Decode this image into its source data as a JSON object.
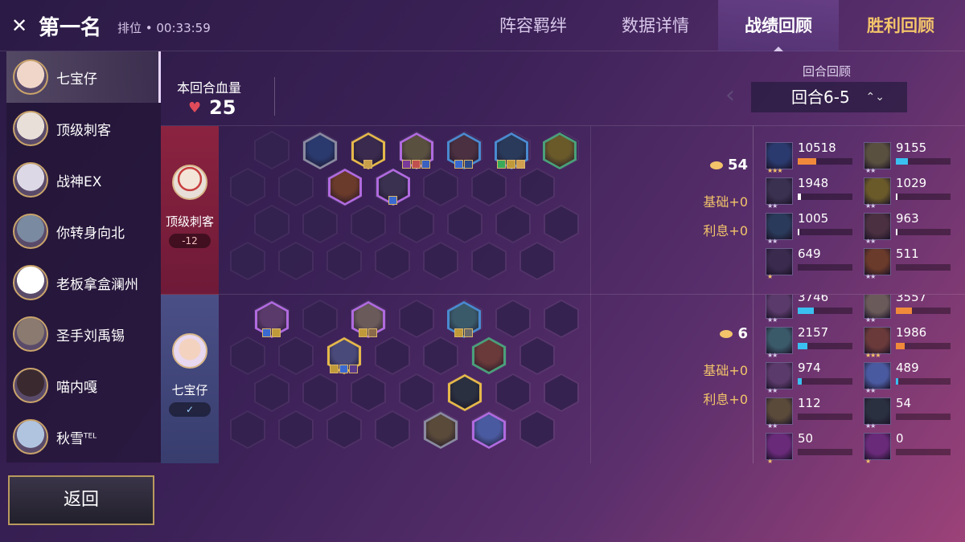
{
  "header": {
    "title": "第一名",
    "subtitle": "排位 • 00:33:59",
    "logo_icon": "crossed-swords-icon"
  },
  "tabs": [
    {
      "label": "阵容羁绊",
      "state": "normal"
    },
    {
      "label": "数据详情",
      "state": "normal"
    },
    {
      "label": "战绩回顾",
      "state": "active"
    },
    {
      "label": "胜利回顾",
      "state": "gold"
    }
  ],
  "players": [
    {
      "name": "七宝仔",
      "avatar_color": "#f0d6c8",
      "selected": true
    },
    {
      "name": "顶级刺客",
      "avatar_color": "#e8e0d8",
      "selected": false
    },
    {
      "name": "战神EX",
      "avatar_color": "#dcd8e6",
      "selected": false
    },
    {
      "name": "你转身向北",
      "avatar_color": "#7a8aa0",
      "selected": false
    },
    {
      "name": "老板拿盒澜州",
      "avatar_color": "#ffffff",
      "selected": false
    },
    {
      "name": "圣手刘禹锡",
      "avatar_color": "#8a7a70",
      "selected": false
    },
    {
      "name": "喵内嘎",
      "avatar_color": "#3a2a30",
      "selected": false
    },
    {
      "name": "秋雪",
      "suffix": "TEL",
      "avatar_color": "#b0c4e0",
      "selected": false
    }
  ],
  "back_button": "返回",
  "round_hp": {
    "label": "本回合血量",
    "value": "25",
    "icon": "heart-icon"
  },
  "round_review": {
    "label": "回合回顾",
    "value": "回合6-5",
    "prev_icon": "chevron-left-icon",
    "toggle_icon": "up-down-icon"
  },
  "opponent": {
    "name": "顶级刺客",
    "badge": "-12",
    "gold": "54",
    "base": "基础+0",
    "interest": "利息+0"
  },
  "self": {
    "name": "七宝仔",
    "badge": "✓",
    "gold": "6",
    "base": "基础+0",
    "interest": "利息+0"
  },
  "opp_units": [
    {
      "c": "#2a3a6e",
      "border": "#8a8aa0",
      "items": []
    },
    {
      "c": "#3a2a4e",
      "border": "#e5b84a",
      "items": [
        "#c9a04a"
      ]
    },
    {
      "c": "#5a5040",
      "border": "#b06adf",
      "items": [
        "#7a3a9a",
        "#c05050",
        "#3a60c0"
      ]
    },
    {
      "c": "#4a3040",
      "border": "#4a8ad0",
      "items": [
        "#3a6ad0",
        "#2a4a8a"
      ]
    },
    {
      "c": "#2a3a5a",
      "border": "#4a8ad0",
      "items": [
        "#3aaa5a",
        "#c09a3a",
        "#d0a050"
      ]
    },
    {
      "c": "#6a5a2a",
      "border": "#4aa07a",
      "items": []
    },
    {
      "c": "#6a3a2a",
      "border": "#b06adf",
      "items": []
    },
    {
      "c": "#3a3050",
      "border": "#b06adf",
      "items": [
        "#3a6ad0"
      ]
    }
  ],
  "self_units": [
    {
      "c": "#5a3a6a",
      "border": "#b06adf",
      "items": [
        "#3a6ad0",
        "#c09a3a"
      ]
    },
    {
      "c": "#6a5a5a",
      "border": "#b06adf",
      "items": [
        "#c09a3a",
        "#8a6a4a"
      ]
    },
    {
      "c": "#3a5a6a",
      "border": "#4a8ad0",
      "items": [
        "#c09a3a",
        "#6a6a6a"
      ]
    },
    {
      "c": "#4a4a7a",
      "border": "#e5b84a",
      "items": [
        "#c09a3a",
        "#3a6ad0",
        "#5a3a8a"
      ]
    },
    {
      "c": "#6a3a3a",
      "border": "#4aa07a",
      "items": []
    },
    {
      "c": "#2a3040",
      "border": "#e5b84a",
      "items": []
    },
    {
      "c": "#5a4a3a",
      "border": "#8a8aa0",
      "items": []
    },
    {
      "c": "#4a5aa0",
      "border": "#b06adf",
      "items": []
    }
  ],
  "opp_stats": [
    {
      "val": "10518",
      "fill": 0.34,
      "color": "#f08a3a",
      "stars": "★★★",
      "star_color": "#f3c46a",
      "c": "#2a3a6e"
    },
    {
      "val": "9155",
      "fill": 0.22,
      "color": "#3ac0f0",
      "stars": "★★",
      "star_color": "#d8cdea",
      "c": "#5a5040"
    },
    {
      "val": "1948",
      "fill": 0.06,
      "color": "#ffffff",
      "stars": "★★",
      "star_color": "#d8cdea",
      "c": "#3a3050"
    },
    {
      "val": "1029",
      "fill": 0.03,
      "color": "#ffffff",
      "stars": "★★",
      "star_color": "#d8cdea",
      "c": "#6a5a2a"
    },
    {
      "val": "1005",
      "fill": 0.03,
      "color": "#ffffff",
      "stars": "★★",
      "star_color": "#d8cdea",
      "c": "#2a3a5a"
    },
    {
      "val": "963",
      "fill": 0.03,
      "color": "#ffffff",
      "stars": "★★",
      "star_color": "#d8cdea",
      "c": "#4a3040"
    },
    {
      "val": "649",
      "fill": 0.0,
      "color": "#ffffff",
      "stars": "★",
      "star_color": "#f3c46a",
      "c": "#3a2a4e"
    },
    {
      "val": "511",
      "fill": 0.0,
      "color": "#ffffff",
      "stars": "★★",
      "star_color": "#d8cdea",
      "c": "#6a3a2a"
    }
  ],
  "self_stats": [
    {
      "val": "3746",
      "fill": 0.3,
      "color": "#3ac0f0",
      "stars": "★★",
      "star_color": "#d8cdea",
      "c": "#5a3a6a"
    },
    {
      "val": "3557",
      "fill": 0.3,
      "color": "#f08a3a",
      "stars": "★★",
      "star_color": "#d8cdea",
      "c": "#6a5a5a"
    },
    {
      "val": "2157",
      "fill": 0.18,
      "color": "#3ac0f0",
      "stars": "★★",
      "star_color": "#d8cdea",
      "c": "#3a5a6a"
    },
    {
      "val": "1986",
      "fill": 0.16,
      "color": "#f08a3a",
      "stars": "★★★",
      "star_color": "#f3c46a",
      "c": "#6a3a3a"
    },
    {
      "val": "974",
      "fill": 0.08,
      "color": "#3ac0f0",
      "stars": "★★",
      "star_color": "#d8cdea",
      "c": "#5a3a6a"
    },
    {
      "val": "489",
      "fill": 0.04,
      "color": "#3ac0f0",
      "stars": "★★",
      "star_color": "#d8cdea",
      "c": "#4a5aa0"
    },
    {
      "val": "112",
      "fill": 0.0,
      "color": "#ffffff",
      "stars": "★★",
      "star_color": "#d8cdea",
      "c": "#5a4a3a"
    },
    {
      "val": "54",
      "fill": 0.0,
      "color": "#ffffff",
      "stars": "★★",
      "star_color": "#d8cdea",
      "c": "#2a3040"
    },
    {
      "val": "50",
      "fill": 0.0,
      "color": "#ffffff",
      "stars": "★",
      "star_color": "#f3c46a",
      "c": "#6a2a7a"
    },
    {
      "val": "0",
      "fill": 0.0,
      "color": "#ffffff",
      "stars": "★",
      "star_color": "#f3c46a",
      "c": "#6a2a7a"
    }
  ]
}
